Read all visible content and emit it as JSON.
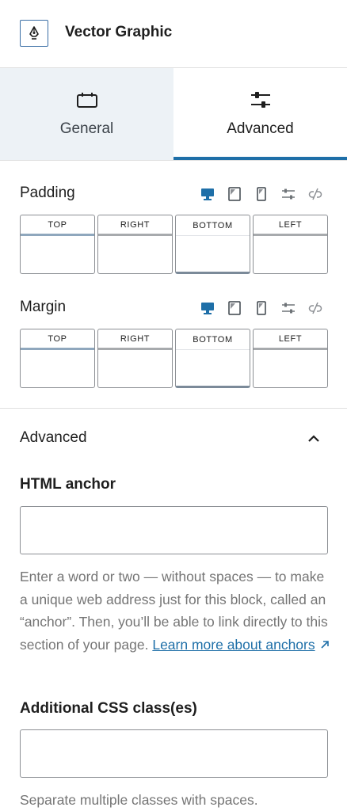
{
  "block": {
    "title": "Vector Graphic",
    "icon": "pen-nib-icon"
  },
  "tabs": [
    {
      "label": "General",
      "icon": "calendar-box-icon",
      "active": false
    },
    {
      "label": "Advanced",
      "icon": "sliders-icon",
      "active": true
    }
  ],
  "padding": {
    "label": "Padding",
    "sides": [
      "TOP",
      "RIGHT",
      "BOTTOM",
      "LEFT"
    ],
    "devices": [
      "desktop-icon",
      "tablet-icon",
      "mobile-icon",
      "sliders-icon",
      "unlink-icon"
    ]
  },
  "margin": {
    "label": "Margin",
    "sides": [
      "TOP",
      "RIGHT",
      "BOTTOM",
      "LEFT"
    ],
    "devices": [
      "desktop-icon",
      "tablet-icon",
      "mobile-icon",
      "sliders-icon",
      "unlink-icon"
    ]
  },
  "advanced_panel": {
    "title": "Advanced",
    "html_anchor_label": "HTML anchor",
    "html_anchor_value": "",
    "html_anchor_help": "Enter a word or two — without spaces — to make a unique web address just for this block, called an “anchor”. Then, you’ll be able to link directly to this section of your page.",
    "html_anchor_link": "Learn more about anchors",
    "css_label": "Additional CSS class(es)",
    "css_value": "",
    "css_help": "Separate multiple classes with spaces."
  },
  "colors": {
    "accent": "#1e6fa8",
    "tab_bg": "#edf2f6",
    "border": "#8c8f94",
    "help_text": "#757575"
  }
}
